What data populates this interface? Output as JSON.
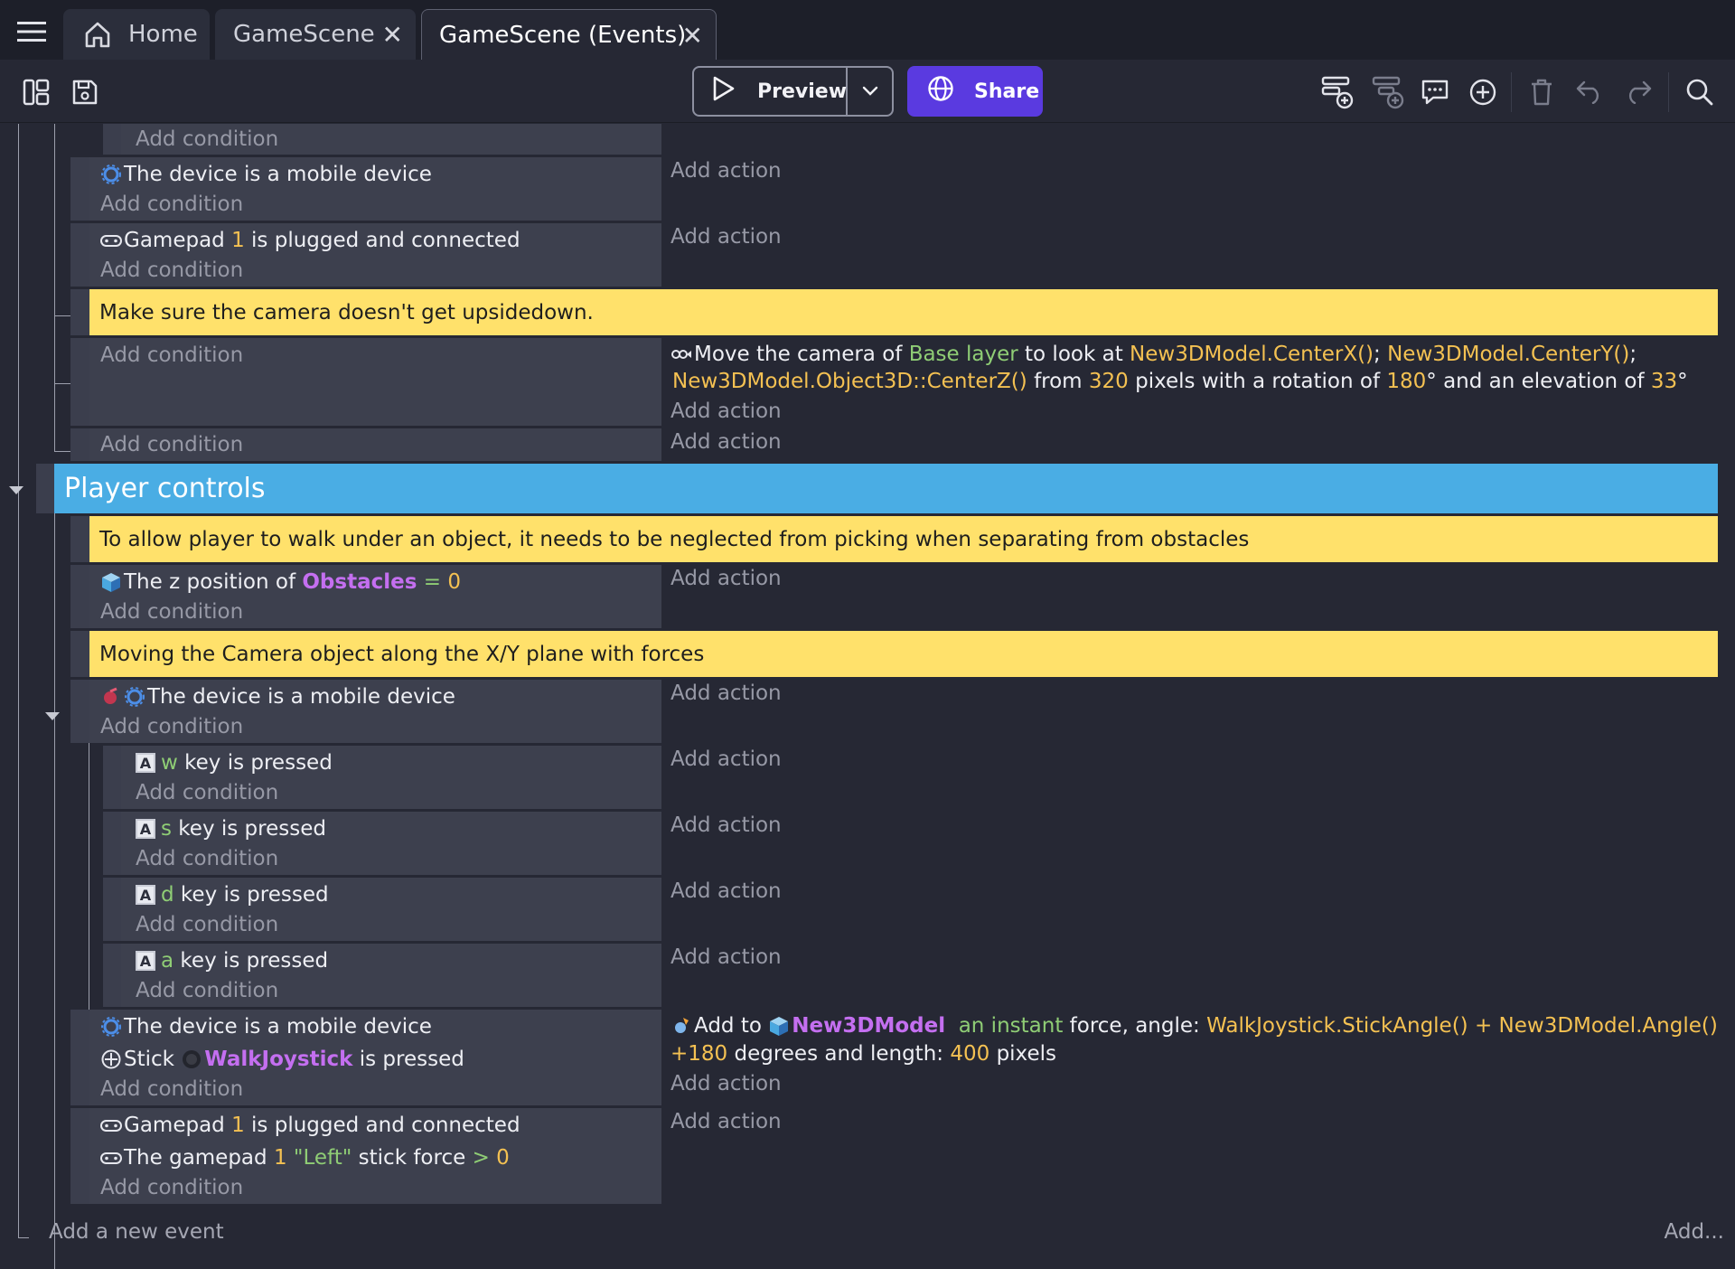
{
  "tabs": [
    {
      "label": "Home"
    },
    {
      "label": "GameScene"
    },
    {
      "label": "GameScene (Events)"
    }
  ],
  "toolbar": {
    "preview_label": "Preview",
    "share_label": "Share"
  },
  "events": {
    "top_add_condition": "Add condition",
    "e1_cond": "The device is a mobile device",
    "e1_addc": "Add condition",
    "e1_adda": "Add action",
    "e2_cond_pre": "Gamepad",
    "e2_cond_num": "1",
    "e2_cond_post": "is plugged and connected",
    "e2_addc": "Add condition",
    "e2_adda": "Add action",
    "comment1": "Make sure the camera doesn't get upsidedown.",
    "e3_addc": "Add condition",
    "e3_act_a": "Move the camera of",
    "e3_act_layer": "Base layer",
    "e3_act_b": "to look at",
    "e3_act_x": "New3DModel.CenterX()",
    "e3_act_sep1": ";",
    "e3_act_y": "New3DModel.CenterY()",
    "e3_act_sep2": ";",
    "e3_act_z": "New3DModel.Object3D::CenterZ()",
    "e3_act_c": "from",
    "e3_act_dist": "320",
    "e3_act_d": "pixels with a rotation of",
    "e3_act_rot": "180",
    "e3_act_e": "° and an elevation of",
    "e3_act_elev": "33",
    "e3_act_f": "°",
    "e3_adda": "Add action",
    "e4_addc": "Add condition",
    "e4_adda": "Add action",
    "group_title": "Player controls",
    "comment2": "To allow player to walk under an object, it needs to be neglected from picking when separating from obstacles",
    "e5_cond_a": "The z position of",
    "e5_cond_obj": "Obstacles",
    "e5_cond_op": "=",
    "e5_cond_val": "0",
    "e5_addc": "Add condition",
    "e5_adda": "Add action",
    "comment3": "Moving the Camera object along the X/Y plane with forces",
    "e6_cond": "The device is a mobile device",
    "e6_addc": "Add condition",
    "e6_adda": "Add action",
    "sub_keys": [
      {
        "key": "w",
        "text": "key is pressed",
        "addc": "Add condition",
        "adda": "Add action"
      },
      {
        "key": "s",
        "text": "key is pressed",
        "addc": "Add condition",
        "adda": "Add action"
      },
      {
        "key": "d",
        "text": "key is pressed",
        "addc": "Add condition",
        "adda": "Add action"
      },
      {
        "key": "a",
        "text": "key is pressed",
        "addc": "Add condition",
        "adda": "Add action"
      }
    ],
    "e7_cond1": "The device is a mobile device",
    "e7_cond2_a": "Stick",
    "e7_cond2_obj": "WalkJoystick",
    "e7_cond2_b": "is pressed",
    "e7_addc": "Add condition",
    "e7_act_a": "Add to",
    "e7_act_obj": "New3DModel",
    "e7_act_kind": "an instant",
    "e7_act_b": "force, angle:",
    "e7_act_angle": "WalkJoystick.StickAngle() + New3DModel.Angle()",
    "e7_act_angle2": "+180",
    "e7_act_c": "degrees and length:",
    "e7_act_len": "400",
    "e7_act_d": "pixels",
    "e7_adda": "Add action",
    "e8_cond1_pre": "Gamepad",
    "e8_cond1_num": "1",
    "e8_cond1_post": "is plugged and connected",
    "e8_cond2_a": "The gamepad",
    "e8_cond2_num": "1",
    "e8_cond2_stick": "\"Left\"",
    "e8_cond2_b": "stick force",
    "e8_cond2_op": ">",
    "e8_cond2_val": "0",
    "e8_addc": "Add condition",
    "e8_adda": "Add action"
  },
  "footer": {
    "add_event": "Add a new event",
    "add_more": "Add..."
  },
  "colors": {
    "background": "#262834",
    "comment": "#ffe16b",
    "group": "#4aade4",
    "share": "#5a3ae0",
    "param_yellow": "#f4c152",
    "param_green": "#8fcd75",
    "object_purple": "#c46ff0"
  },
  "icons": [
    "menu-icon",
    "home-icon",
    "close-icon",
    "layout-icon",
    "save-icon",
    "play-icon",
    "chevron-down-icon",
    "globe-icon",
    "add-event-icon",
    "add-subevent-icon",
    "add-comment-icon",
    "add-other-icon",
    "trash-icon",
    "undo-icon",
    "redo-icon",
    "search-icon",
    "device-gear-icon",
    "gamepad-icon",
    "camera-icon",
    "cube-icon",
    "keyboard-key-icon",
    "joystick-icon",
    "force-icon"
  ]
}
